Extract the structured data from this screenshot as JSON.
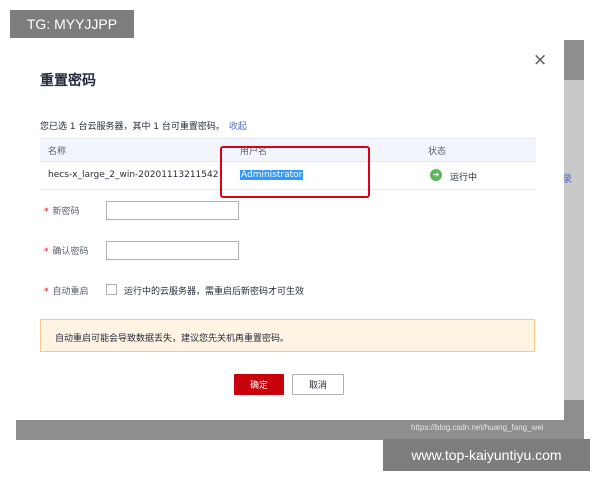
{
  "watermarks": {
    "top_left": "TG: MYYJJPP",
    "bottom_right": "www.top-kaiyuntiyu.com",
    "csdn": "https://blog.csdn.net/huang_fang_wei"
  },
  "background": {
    "fragment_text": "录"
  },
  "dialog": {
    "title": "重置密码",
    "close_symbol": "×",
    "info_text": "您已选 1 台云服务器，其中 1 台可重置密码。",
    "collapse_link": "收起",
    "table": {
      "headers": [
        "名称",
        "用户名",
        "状态"
      ],
      "rows": [
        {
          "name": "hecs-x_large_2_win-20201113211542",
          "username": "Administrator",
          "status": "运行中",
          "status_icon": "arrow-right-circle-icon"
        }
      ]
    },
    "form": {
      "required_mark": "*",
      "new_password_label": "新密码",
      "new_password_value": "",
      "confirm_password_label": "确认密码",
      "confirm_password_value": "",
      "auto_restart_label": "自动重启",
      "auto_restart_checked": false,
      "auto_restart_text": "运行中的云服务器，需重启后新密码才可生效"
    },
    "warning": "自动重启可能会导致数据丢失，建议您先关机再重置密码。",
    "buttons": {
      "ok": "确定",
      "cancel": "取消"
    },
    "colors": {
      "primary": "#c7000b",
      "highlight_box": "#d9001b",
      "running": "#5cb85c",
      "link": "#526ecc",
      "warning_bg": "#fff4e3"
    }
  }
}
